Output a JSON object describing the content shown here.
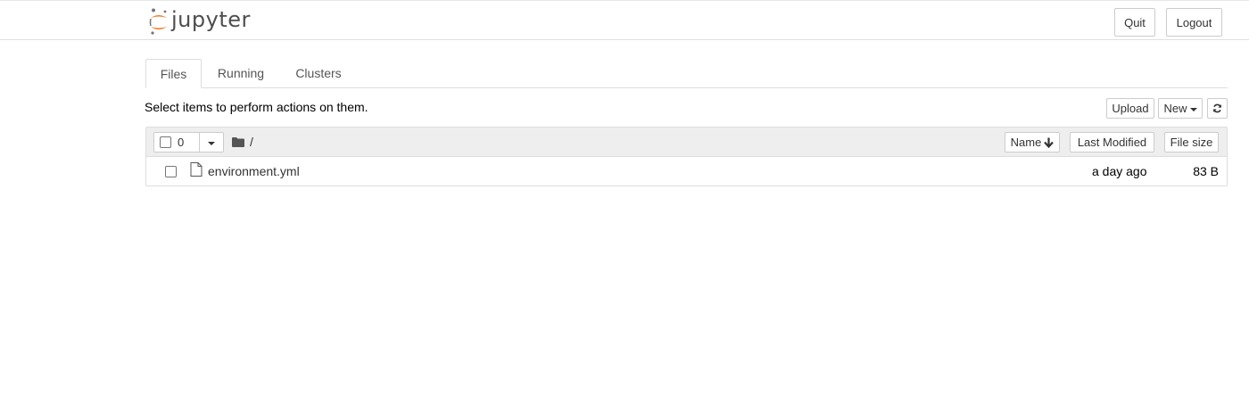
{
  "app": {
    "logo_text": "jupyter",
    "quit_label": "Quit",
    "logout_label": "Logout"
  },
  "tabs": [
    {
      "label": "Files",
      "active": true
    },
    {
      "label": "Running",
      "active": false
    },
    {
      "label": "Clusters",
      "active": false
    }
  ],
  "toolbar": {
    "instructions": "Select items to perform actions on them.",
    "upload_label": "Upload",
    "new_label": "New",
    "refresh_icon": "refresh-icon"
  },
  "file_list": {
    "selected_count": "0",
    "breadcrumb_path": "/",
    "sort_buttons": {
      "name": "Name",
      "last_modified": "Last Modified",
      "file_size": "File size"
    },
    "sort_active": "name-descending",
    "items": [
      {
        "name": "environment.yml",
        "modified": "a day ago",
        "size": "83 B",
        "icon": "file-icon"
      }
    ]
  },
  "colors": {
    "logo_orange": "#f37726",
    "logo_gray": "#767677",
    "header_bg": "#eeeeee",
    "border": "#dddddd"
  }
}
